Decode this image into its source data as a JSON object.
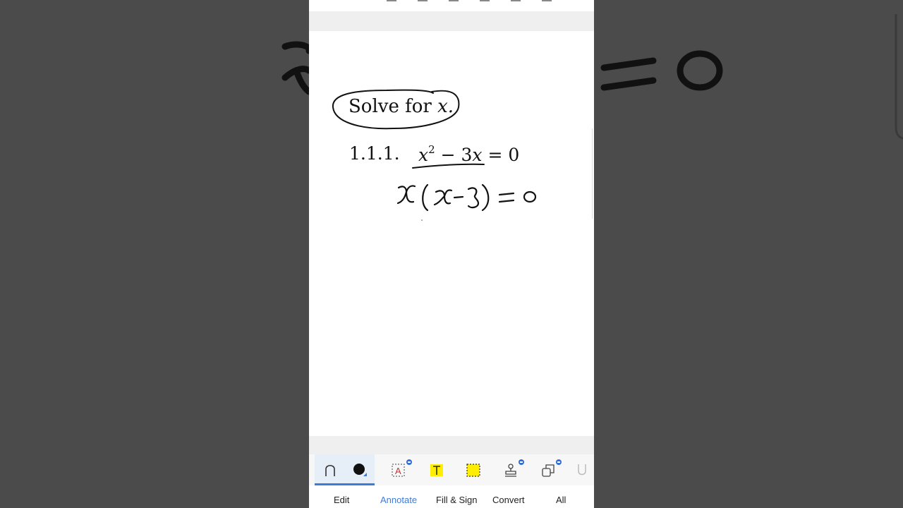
{
  "document": {
    "heading_prefix": "Solve for ",
    "heading_var": "x.",
    "problem_number": "1.1.1.",
    "problem_eq_x": "x",
    "problem_eq_exp": "2",
    "problem_eq_rest_1": " − 3",
    "problem_eq_x2": "x",
    "problem_eq_rest_2": " = 0"
  },
  "handwriting": {
    "factored": "x(x−3)=0"
  },
  "tabs": [
    {
      "label": "Edit"
    },
    {
      "label": "Annotate",
      "active": true
    },
    {
      "label": "Fill & Sign"
    },
    {
      "label": "Convert"
    },
    {
      "label": "All"
    }
  ],
  "toolbar": {
    "tools": [
      "pen-tool",
      "color-picker",
      "text-box-tool",
      "text-highlight-tool",
      "area-highlight-tool",
      "stamp-tool",
      "shapes-tool",
      "underline-tool"
    ]
  },
  "colors": {
    "accent": "#3d7bd9",
    "highlight": "#ffee00",
    "ink": "#111111"
  }
}
